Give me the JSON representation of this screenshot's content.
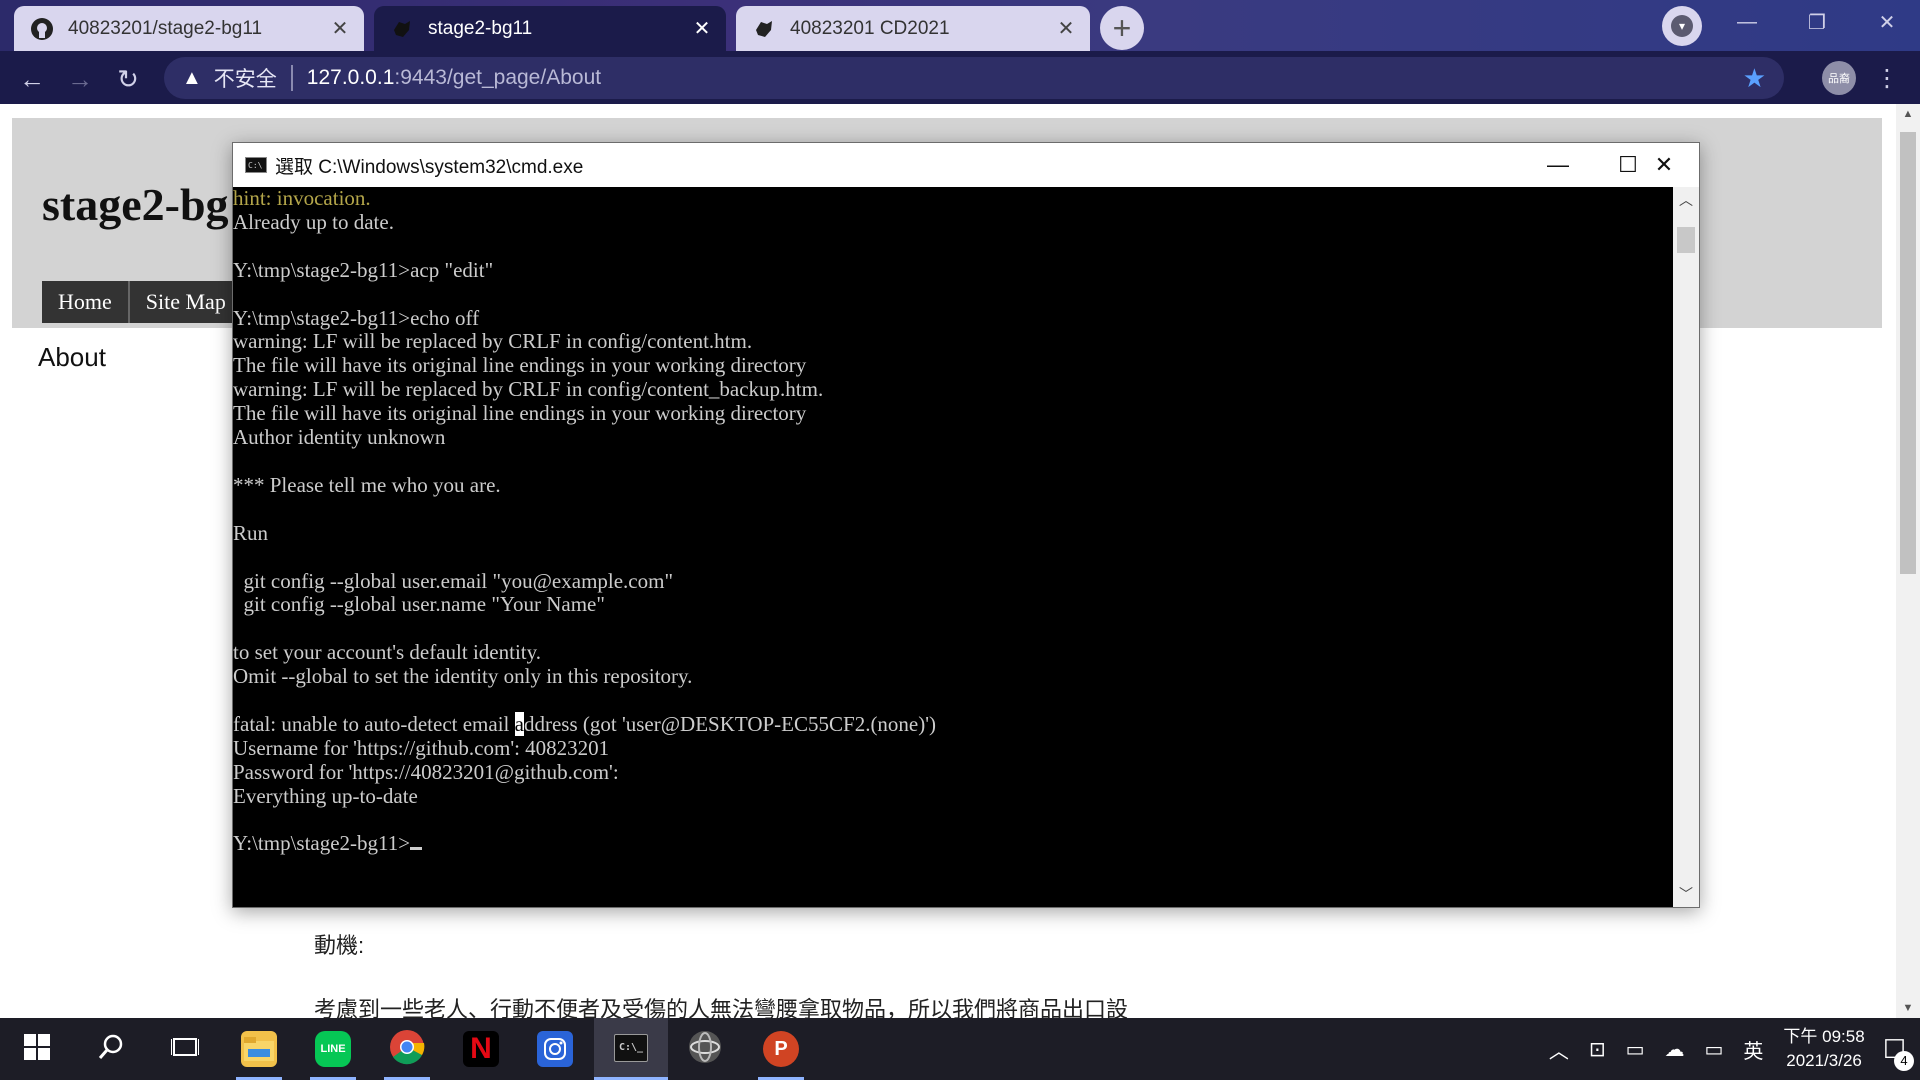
{
  "browser": {
    "tabs": [
      {
        "title": "40823201/stage2-bg11",
        "icon": "github-icon"
      },
      {
        "title": "stage2-bg11",
        "icon": "cmsimde-icon"
      },
      {
        "title": "40823201 CD2021",
        "icon": "cmsimde-icon"
      }
    ],
    "new_tab": "+",
    "address": {
      "warning": "不安全",
      "host": "127.0.0.1",
      "path": ":9443/get_page/About"
    },
    "profile": "品裔"
  },
  "site": {
    "title": "stage2-bg11",
    "nav": [
      "Home",
      "Site Map"
    ],
    "page_link": "About",
    "motive_label": "動機:",
    "description": "考慮到一些老人、行動不便者及受傷的人無法彎腰拿取物品，所以我們將商品出口設"
  },
  "cmd": {
    "title": "選取 C:\\Windows\\system32\\cmd.exe",
    "lines": [
      "hint: invocation.",
      "Already up to date.",
      "",
      "Y:\\tmp\\stage2-bg11>acp \"edit\"",
      "",
      "Y:\\tmp\\stage2-bg11>echo off",
      "warning: LF will be replaced by CRLF in config/content.htm.",
      "The file will have its original line endings in your working directory",
      "warning: LF will be replaced by CRLF in config/content_backup.htm.",
      "The file will have its original line endings in your working directory",
      "Author identity unknown",
      "",
      "*** Please tell me who you are.",
      "",
      "Run",
      "",
      "  git config --global user.email \"you@example.com\"",
      "  git config --global user.name \"Your Name\"",
      "",
      "to set your account's default identity.",
      "Omit --global to set the identity only in this repository.",
      "",
      "fatal: unable to auto-detect email address (got 'user@DESKTOP-EC55CF2.(none)')",
      "Username for 'https://github.com': 40823201",
      "Password for 'https://40823201@github.com':",
      "Everything up-to-date",
      "",
      "Y:\\tmp\\stage2-bg11>"
    ]
  },
  "taskbar": {
    "apps": [
      "start-icon",
      "search-icon",
      "task-view-icon",
      "file-explorer-icon",
      "line-icon",
      "chrome-icon",
      "netflix-icon",
      "instagram-icon",
      "cmd-icon",
      "siri-icon",
      "powerpoint-icon"
    ],
    "ime": "英",
    "time": "下午 09:58",
    "date": "2021/3/26",
    "notifications": "4"
  }
}
